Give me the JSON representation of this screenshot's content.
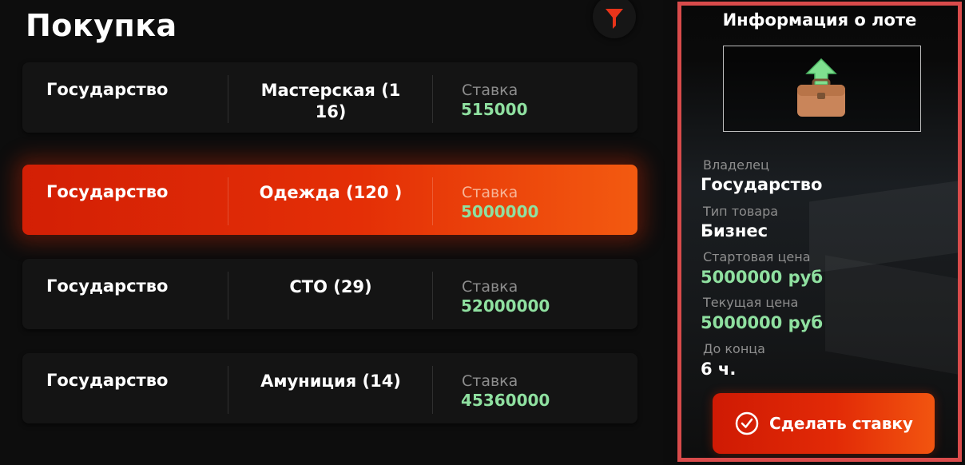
{
  "header": {
    "title": "Покупка",
    "filter_icon": "filter-icon"
  },
  "colors": {
    "accent": "#e42f06",
    "price_green": "#8fe0a0",
    "highlight_border": "#d94b4b"
  },
  "lots": [
    {
      "owner": "Государство",
      "item": "Мастерская (116)",
      "bid_label": "Ставка",
      "bid_value": "515000",
      "selected": false
    },
    {
      "owner": "Государство",
      "item": "Одежда (120 )",
      "bid_label": "Ставка",
      "bid_value": "5000000",
      "selected": true
    },
    {
      "owner": "Государство",
      "item": "СТО (29)",
      "bid_label": "Ставка",
      "bid_value": "52000000",
      "selected": false
    },
    {
      "owner": "Государство",
      "item": "Амуниция (14)",
      "bid_label": "Ставка",
      "bid_value": "45360000",
      "selected": false
    }
  ],
  "lot_info": {
    "title": "Информация о лоте",
    "image_icon": "briefcase-upgrade-icon",
    "owner_label": "Владелец",
    "owner_value": "Государство",
    "type_label": "Тип товара",
    "type_value": "Бизнес",
    "start_price_label": "Стартовая цена",
    "start_price_value": "5000000 руб",
    "current_price_label": "Текущая цена",
    "current_price_value": "5000000 руб",
    "time_left_label": "До конца",
    "time_left_value": "6 ч.",
    "bid_button_label": "Сделать ставку",
    "bid_button_icon": "check-circle-icon"
  }
}
